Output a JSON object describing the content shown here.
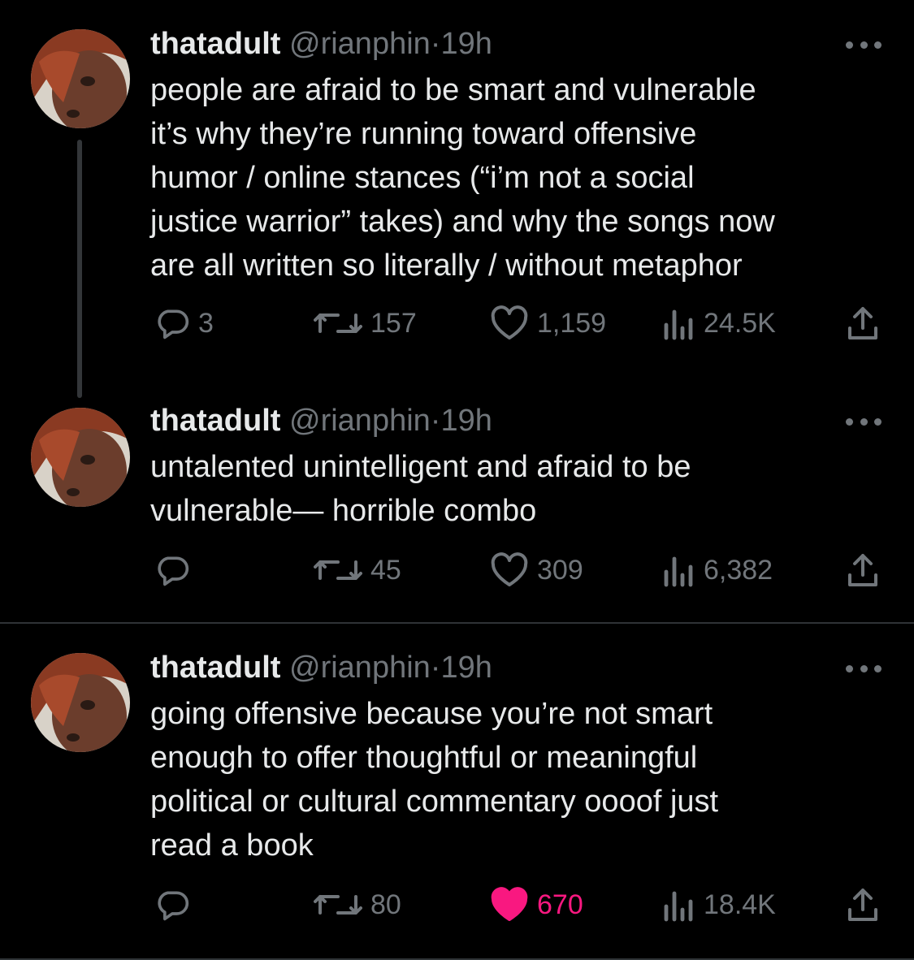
{
  "colors": {
    "background": "#000000",
    "text": "#e7e9ea",
    "muted": "#71767b",
    "like_active": "#f91880"
  },
  "tweets": [
    {
      "name": "thatadult",
      "handle": "@rianphin",
      "dot": "·",
      "time": "19h",
      "text": "people are afraid to be smart and vulnerable\nit’s why they’re running toward offensive\nhumor / online stances (“i’m not a social\njustice warrior” takes) and why the songs now\nare all written so literally / without metaphor",
      "replies": "3",
      "retweets": "157",
      "likes": "1,159",
      "views": "24.5K",
      "liked": false
    },
    {
      "name": "thatadult",
      "handle": "@rianphin",
      "dot": "·",
      "time": "19h",
      "text": "untalented unintelligent and afraid to be\nvulnerable— horrible combo",
      "replies": "",
      "retweets": "45",
      "likes": "309",
      "views": "6,382",
      "liked": false
    },
    {
      "name": "thatadult",
      "handle": "@rianphin",
      "dot": "·",
      "time": "19h",
      "text": "going offensive because you’re not smart\nenough to offer thoughtful or meaningful\npolitical or cultural commentary oooof just\nread a book",
      "replies": "",
      "retweets": "80",
      "likes": "670",
      "views": "18.4K",
      "liked": true
    }
  ],
  "icons": [
    "avatar",
    "more-icon",
    "reply-icon",
    "retweet-icon",
    "like-icon",
    "views-icon",
    "share-icon"
  ]
}
